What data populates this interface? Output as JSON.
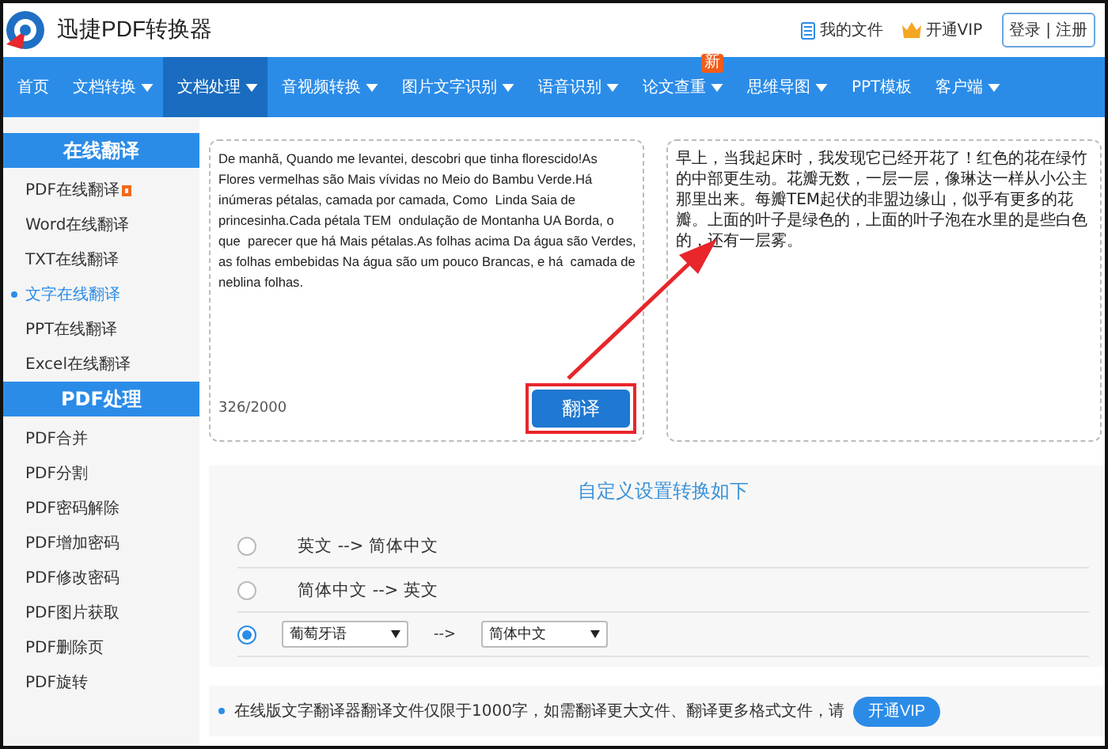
{
  "header": {
    "logo_text": "迅捷PDF转换器",
    "links": [
      {
        "label": "我的文件",
        "kind": "files"
      },
      {
        "label": "开通VIP",
        "kind": "vip"
      }
    ],
    "login": "登录",
    "register": "注册",
    "separator": "|"
  },
  "nav": [
    {
      "label": "首页",
      "has_menu": false,
      "selected": false
    },
    {
      "label": "文档转换",
      "has_menu": true,
      "selected": false
    },
    {
      "label": "文档处理",
      "has_menu": true,
      "selected": true
    },
    {
      "label": "音视频转换",
      "has_menu": true,
      "selected": false
    },
    {
      "label": "图片文字识别",
      "has_menu": true,
      "selected": false
    },
    {
      "label": "语音识别",
      "has_menu": true,
      "selected": false
    },
    {
      "label": "论文查重",
      "has_menu": true,
      "selected": false,
      "badge": "新"
    },
    {
      "label": "思维导图",
      "has_menu": true,
      "selected": false
    },
    {
      "label": "PPT模板",
      "has_menu": false,
      "selected": false
    },
    {
      "label": "客户端",
      "has_menu": true,
      "selected": false
    }
  ],
  "sidebar": [
    {
      "title": "在线翻译",
      "items": [
        {
          "label": "PDF在线翻译",
          "selected": false,
          "flag": true
        },
        {
          "label": "Word在线翻译",
          "selected": false
        },
        {
          "label": "TXT在线翻译",
          "selected": false
        },
        {
          "label": "文字在线翻译",
          "selected": true
        },
        {
          "label": "PPT在线翻译",
          "selected": false
        },
        {
          "label": "Excel在线翻译",
          "selected": false
        }
      ]
    },
    {
      "title": "PDF处理",
      "items": [
        {
          "label": "PDF合并",
          "selected": false
        },
        {
          "label": "PDF分割",
          "selected": false
        },
        {
          "label": "PDF密码解除",
          "selected": false
        },
        {
          "label": "PDF增加密码",
          "selected": false
        },
        {
          "label": "PDF修改密码",
          "selected": false
        },
        {
          "label": "PDF图片获取",
          "selected": false
        },
        {
          "label": "PDF删除页",
          "selected": false
        },
        {
          "label": "PDF旋转",
          "selected": false
        }
      ]
    }
  ],
  "source": {
    "value": "De manhã, Quando me levantei, descobri que tinha florescido!As Flores vermelhas são Mais vívidas no Meio do Bambu Verde.Há inúmeras pétalas, camada por camada, Como  Linda Saia de princesinha.Cada pétala TEM  ondulação de Montanha UA Borda, o que  parecer que há Mais pétalas.As folhas acima Da água são Verdes,  as folhas embebidas Na água são um pouco Brancas, e há  camada de neblina folhas.",
    "count": "326/2000",
    "button": "翻译"
  },
  "result": {
    "value": "早上，当我起床时，我发现它已经开花了！红色的花在绿竹的中部更生动。花瓣无数，一层一层，像琳达一样从小公主那里出来。每瓣TEM起伏的非盟边缘山，似乎有更多的花瓣。上面的叶子是绿色的，上面的叶子泡在水里的是些白色的，还有一层雾。"
  },
  "options": {
    "title": "自定义设置转换如下",
    "rows": [
      {
        "kind": "text",
        "label": "英文 --> 简体中文",
        "selected": false
      },
      {
        "kind": "text",
        "label": "简体中文 --> 英文",
        "selected": false
      },
      {
        "kind": "selects",
        "from": "葡萄牙语",
        "arrow": "-->",
        "to": "简体中文",
        "selected": true
      }
    ]
  },
  "notice": {
    "text": "在线版文字翻译器翻译文件仅限于1000字，如需翻译更大文件、翻译更多格式文件，请",
    "button": "开通VIP"
  }
}
